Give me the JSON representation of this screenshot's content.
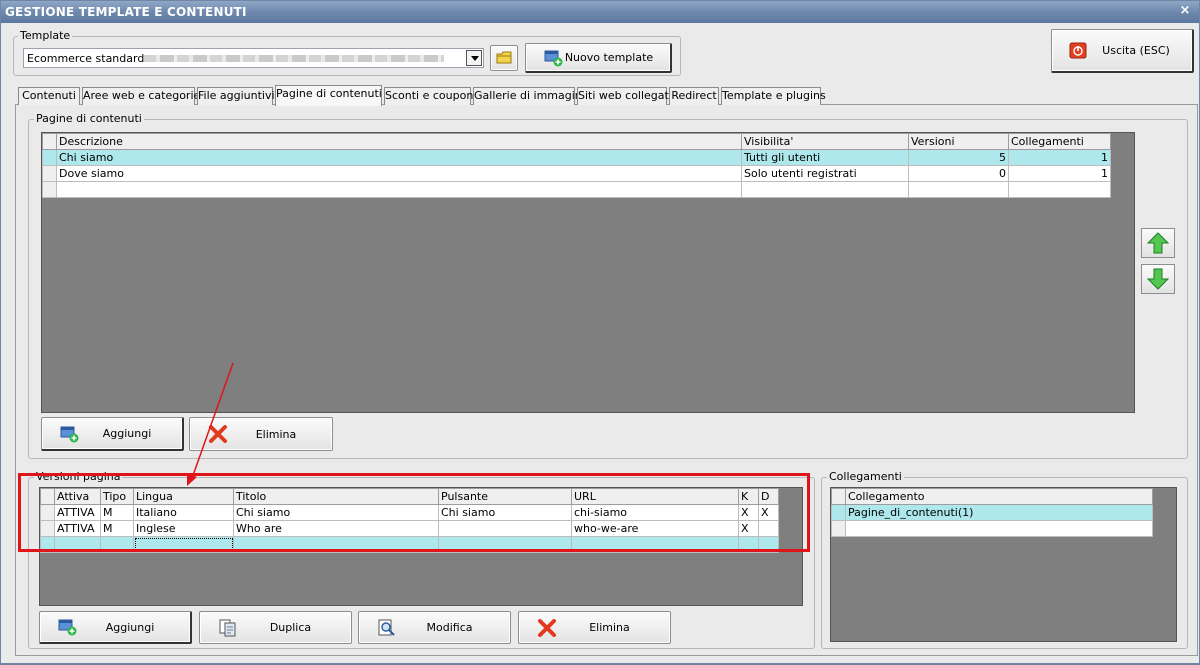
{
  "window": {
    "title": "GESTIONE TEMPLATE E CONTENUTI",
    "close_glyph": "×"
  },
  "template_group": {
    "label": "Template",
    "selected_value": "Ecommerce standard",
    "new_button": "Nuovo template"
  },
  "exit_button": "Uscita (ESC)",
  "tabs": [
    "Contenuti",
    "Aree web e categorie",
    "File aggiuntivi",
    "Pagine di contenuti",
    "Sconti e coupon",
    "Gallerie di immagini",
    "Siti web collegati",
    "Redirect",
    "Template e plugins"
  ],
  "active_tab_index": 3,
  "pages_group": {
    "label": "Pagine di contenuti",
    "columns": [
      "Descrizione",
      "Visibilita'",
      "Versioni",
      "Collegamenti"
    ],
    "rows": [
      [
        "Chi siamo",
        "Tutti gli utenti",
        "5",
        "1"
      ],
      [
        "Dove siamo",
        "Solo utenti registrati",
        "0",
        "1"
      ]
    ],
    "add_button": "Aggiungi",
    "delete_button": "Elimina"
  },
  "versions_group": {
    "label": "Versioni pagina",
    "columns": [
      "Attiva",
      "Tipo",
      "Lingua",
      "Titolo",
      "Pulsante",
      "URL",
      "K",
      "D"
    ],
    "rows": [
      [
        "ATTIVA",
        "M",
        "Italiano",
        "Chi siamo",
        "Chi siamo",
        "chi-siamo",
        "X",
        "X"
      ],
      [
        "ATTIVA",
        "M",
        "Inglese",
        "Who are",
        "",
        "who-we-are",
        "X",
        ""
      ]
    ],
    "add_button": "Aggiungi",
    "duplicate_button": "Duplica",
    "edit_button": "Modifica",
    "delete_button": "Elimina"
  },
  "links_group": {
    "label": "Collegamenti",
    "columns": [
      "Collegamento"
    ],
    "rows": [
      [
        "Pagine_di_contenuti(1)"
      ]
    ]
  },
  "colors": {
    "titlebar": "#6f89ae",
    "grid_bg": "#7f7f7f",
    "selected_row": "#aee8ec",
    "annotation_red": "#e0151a"
  }
}
